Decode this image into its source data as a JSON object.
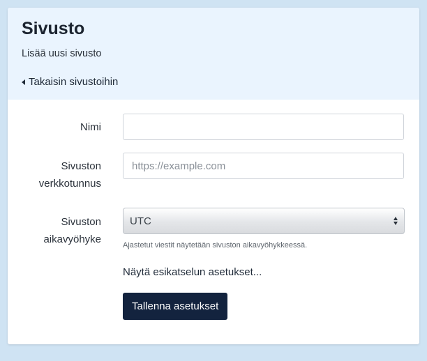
{
  "header": {
    "title": "Sivusto",
    "subtitle": "Lisää uusi sivusto",
    "back_link": "Takaisin sivustoihin"
  },
  "form": {
    "name": {
      "label": "Nimi",
      "value": "",
      "placeholder": ""
    },
    "domain": {
      "label_line1": "Sivuston",
      "label_line2": "verkkotunnus",
      "value": "",
      "placeholder": "https://example.com"
    },
    "timezone": {
      "label_line1": "Sivuston",
      "label_line2": "aikavyöhyke",
      "selected": "UTC",
      "help": "Ajastetut viestit näytetään sivuston aikavyöhykkeessä."
    },
    "preview_link": "Näytä esikatselun asetukset...",
    "save_label": "Tallenna asetukset"
  },
  "colors": {
    "page_background": "#cfe3f3",
    "header_background": "#eaf4fe",
    "primary_button": "#13233e"
  }
}
